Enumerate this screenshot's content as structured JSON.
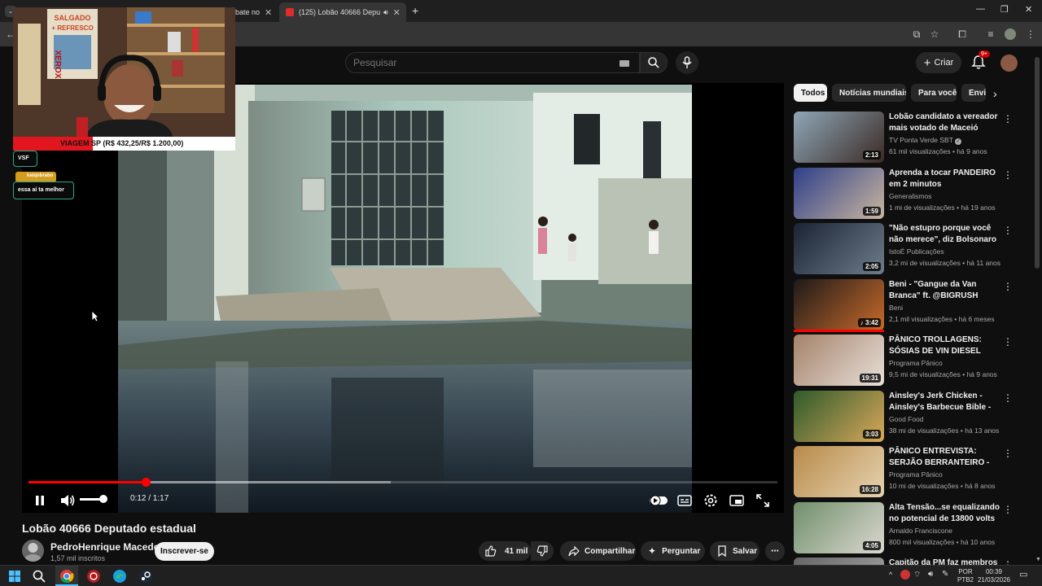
{
  "browser": {
    "tabs": [
      {
        "label": "bate no",
        "active": false
      },
      {
        "label": "(125) Lobão 40666 Deputad",
        "active": true
      }
    ],
    "new_tab": "+"
  },
  "youtube": {
    "search_placeholder": "Pesquisar",
    "create_label": "Criar",
    "notif_count": "9+"
  },
  "player": {
    "time_current": "0:12",
    "time_total": "1:17",
    "time_display": "0:12 / 1:17",
    "progress_fraction": 0.156,
    "buffer_fraction": 0.484,
    "volume_fraction": 0.9
  },
  "overlay": {
    "goal_label": "VIAGEM SP (R$ 432,25/R$ 1.200,00)",
    "goal_current": 432.25,
    "goal_target": 1200.0,
    "chat_user_1_msg": "VSF",
    "chat_user_2_name": "kaiqobrabo",
    "chat_user_2_msg": "essa aí ta melhor",
    "sign_text": "SALGADO + REFRESCO",
    "xerox_text": "XEROX"
  },
  "video": {
    "title": "Lobão 40666 Deputado estadual",
    "channel": "PedroHenrique Macedo",
    "subscribers": "1,57 mil inscritos",
    "subscribe_label": "Inscrever-se",
    "likes": "41 mil",
    "share_label": "Compartilhar",
    "ask_label": "Perguntar",
    "save_label": "Salvar"
  },
  "chips": [
    "Todos",
    "Notícias mundiais",
    "Para você",
    "Envi"
  ],
  "recommendations": [
    {
      "title": "Lobão candidato a vereador mais votado de Maceió",
      "channel": "TV Ponta Verde SBT",
      "verified": true,
      "meta": "61 mil visualizações • há 9 anos",
      "duration": "2:13"
    },
    {
      "title": "Aprenda a tocar PANDEIRO em 2 minutos",
      "channel": "Generalismos",
      "verified": false,
      "meta": "1 mi de visualizações • há 19 anos",
      "duration": "1:59"
    },
    {
      "title": "\"Não estupro porque você não merece\", diz Bolsonaro a Mari...",
      "channel": "IstoÉ Publicações",
      "verified": false,
      "meta": "3,2 mi de visualizações • há 11 anos",
      "duration": "2:05"
    },
    {
      "title": "Beni - \"Gangue da Van Branca\" ft. @BIGRUSH (Prod. tuzin)...",
      "channel": "Beni",
      "verified": false,
      "meta": "2,1 mil visualizações • há 6 meses",
      "duration": "♪ 3:42"
    },
    {
      "title": "PÂNICO TROLLAGENS: SÓSIAS DE VIN DIESEL ENTREVISTAM...",
      "channel": "Programa Pânico",
      "verified": false,
      "meta": "9,5 mi de visualizações • há 9 anos",
      "duration": "19:31"
    },
    {
      "title": "Ainsley's Jerk Chicken - Ainsley's Barbecue Bible - BBC...",
      "channel": "Good Food",
      "verified": false,
      "meta": "38 mi de visualizações • há 13 anos",
      "duration": "3:03"
    },
    {
      "title": "PÂNICO ENTREVISTA: SERJÃO BERRANTEIRO - FIGURAÇAS D...",
      "channel": "Programa Pânico",
      "verified": false,
      "meta": "10 mi de visualizações • há 8 anos",
      "duration": "16:28"
    },
    {
      "title": "Alta Tensão...se equalizando no potencial de 13800 volts",
      "channel": "Arnaldo Franciscone",
      "verified": false,
      "meta": "800 mil visualizações • há 10 anos",
      "duration": "4:05"
    },
    {
      "title": "Capitão da PM faz membros de",
      "channel": "",
      "verified": false,
      "meta": "",
      "duration": ""
    }
  ],
  "taskbar": {
    "lang_top": "POR",
    "lang_bottom": "PTB2",
    "time": "00:39",
    "date": "21/03/2026"
  },
  "colors": {
    "accent_red": "#ff0000",
    "youtube_bg": "#0f0f0f",
    "goal_red": "#e1161f",
    "chat_border": "#2fa88b"
  }
}
